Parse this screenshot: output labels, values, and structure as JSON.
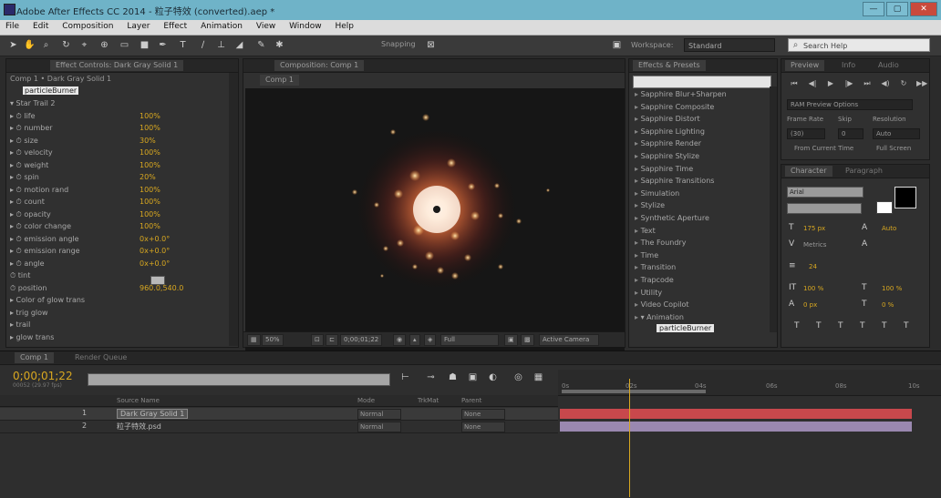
{
  "window": {
    "title": "Adobe After Effects CC 2014 - 粒子特效 (converted).aep *",
    "btn_min": "—",
    "btn_max": "▢",
    "btn_close": "✕"
  },
  "menu": [
    "File",
    "Edit",
    "Composition",
    "Layer",
    "Effect",
    "Animation",
    "View",
    "Window",
    "Help"
  ],
  "toolbar": {
    "snapping": "Snapping",
    "workspace_label": "Workspace:",
    "workspace_value": "Standard",
    "search_placeholder": "Search Help"
  },
  "effect_controls": {
    "tab": "Effect Controls: Dark Gray Solid 1",
    "breadcrumb": "Comp 1 • Dark Gray Solid 1",
    "effect_name": "particleBurner",
    "rows": [
      {
        "label": "▾ Star Trail 2",
        "val": ""
      },
      {
        "label": "▸ ⏱ life",
        "val": "100%"
      },
      {
        "label": "▸ ⏱ number",
        "val": "100%"
      },
      {
        "label": "▸ ⏱ size",
        "val": "30%"
      },
      {
        "label": "▸ ⏱ velocity",
        "val": "100%"
      },
      {
        "label": "▸ ⏱ weight",
        "val": "100%"
      },
      {
        "label": "▸ ⏱ spin",
        "val": "20%"
      },
      {
        "label": "▸ ⏱ motion rand",
        "val": "100%"
      },
      {
        "label": "▸ ⏱ count",
        "val": "100%"
      },
      {
        "label": "▸ ⏱ opacity",
        "val": "100%"
      },
      {
        "label": "▸ ⏱ color change",
        "val": "100%"
      },
      {
        "label": "▸ ⏱ emission angle",
        "val": "0x+0.0°"
      },
      {
        "label": "▸ ⏱ emission range",
        "val": "0x+0.0°"
      },
      {
        "label": "▸ ⏱ angle",
        "val": "0x+0.0°"
      },
      {
        "label": "  ⏱ tint",
        "val": ""
      },
      {
        "label": "  ⏱ position",
        "val": "960.0,540.0"
      },
      {
        "label": "▸ Color of glow trans",
        "val": ""
      },
      {
        "label": "▸ trig glow",
        "val": ""
      },
      {
        "label": "▸ trail",
        "val": ""
      },
      {
        "label": "▸ glow trans",
        "val": ""
      }
    ]
  },
  "composition": {
    "tab": "Composition: Comp 1",
    "subtab": "Comp 1",
    "bottom": {
      "zoom": "50%",
      "time": "0;00;01;22",
      "quality": "Full",
      "camera": "Active Camera"
    }
  },
  "effects_presets": {
    "tab": "Effects & Presets",
    "items": [
      "Sapphire Blur+Sharpen",
      "Sapphire Composite",
      "Sapphire Distort",
      "Sapphire Lighting",
      "Sapphire Render",
      "Sapphire Stylize",
      "Sapphire Time",
      "Sapphire Transitions",
      "Simulation",
      "Stylize",
      "Synthetic Aperture",
      "Text",
      "The Foundry",
      "Time",
      "Transition",
      "Trapcode",
      "Utility",
      "Video Copilot",
      "▾ Animation"
    ],
    "selected": "particleBurner"
  },
  "preview": {
    "tab": "Preview",
    "tab2": "Info",
    "tab3": "Audio",
    "ram_options": "RAM Preview Options",
    "frame_rate_label": "Frame Rate",
    "skip_label": "Skip",
    "resolution_label": "Resolution",
    "frame_rate": "(30)",
    "skip": "0",
    "resolution": "Auto",
    "from_current": "From Current Time",
    "full_screen": "Full Screen"
  },
  "character": {
    "tab": "Character",
    "tab2": "Paragraph",
    "font": "Arial",
    "size": "175 px",
    "leading": "Auto",
    "tracking": "24",
    "vscale": "100 %",
    "hscale": "100 %",
    "baseline": "0 px",
    "tsume": "0 %",
    "metrics": "Metrics",
    "style_glyph": "T"
  },
  "timeline": {
    "tab": "Comp 1",
    "tab2": "Render Queue",
    "timecode": "0;00;01;22",
    "timecode_sub": "00052 (29.97 fps)",
    "columns": {
      "source": "Source Name",
      "mode": "Mode",
      "trk": "TrkMat",
      "parent": "Parent"
    },
    "layers": [
      {
        "num": "1",
        "name": "Dark Gray Solid 1",
        "mode": "Normal",
        "parent": "None"
      },
      {
        "num": "2",
        "name": "粒子特效.psd",
        "mode": "Normal",
        "parent": "None"
      }
    ],
    "ruler": [
      "0s",
      "02s",
      "04s",
      "06s",
      "08s",
      "10s"
    ],
    "track_colors": {
      "layer1": "#c8484c",
      "layer2": "#9a88b0"
    }
  }
}
